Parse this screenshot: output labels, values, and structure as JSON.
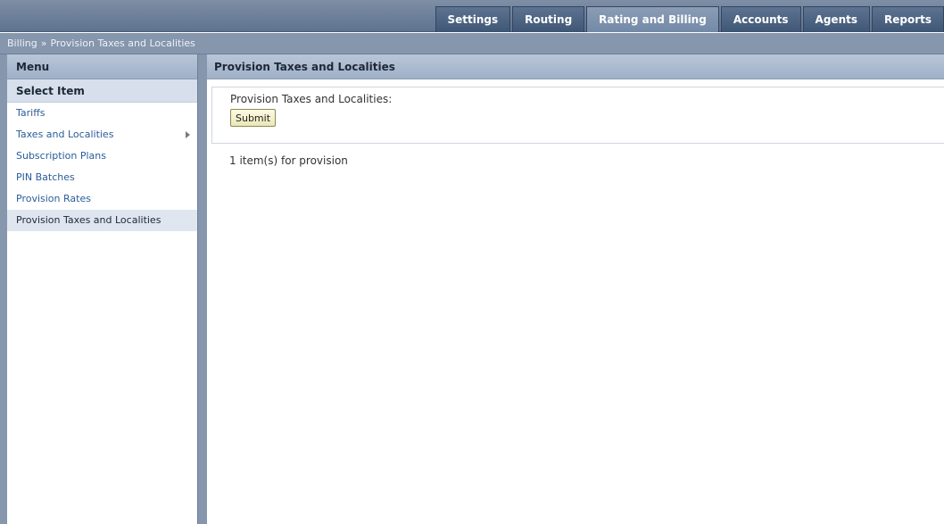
{
  "nav": {
    "tabs": [
      {
        "label": "Settings",
        "active": false
      },
      {
        "label": "Routing",
        "active": false
      },
      {
        "label": "Rating and Billing",
        "active": true
      },
      {
        "label": "Accounts",
        "active": false
      },
      {
        "label": "Agents",
        "active": false
      },
      {
        "label": "Reports",
        "active": false
      }
    ]
  },
  "breadcrumb": {
    "parent": "Billing",
    "separator": "»",
    "current": "Provision Taxes and Localities"
  },
  "sidebar": {
    "title": "Menu",
    "subtitle": "Select Item",
    "items": [
      {
        "label": "Tariffs",
        "has_submenu": false,
        "selected": false
      },
      {
        "label": "Taxes and Localities",
        "has_submenu": true,
        "selected": false
      },
      {
        "label": "Subscription Plans",
        "has_submenu": false,
        "selected": false
      },
      {
        "label": "PIN Batches",
        "has_submenu": false,
        "selected": false
      },
      {
        "label": "Provision Rates",
        "has_submenu": false,
        "selected": false
      },
      {
        "label": "Provision Taxes and Localities",
        "has_submenu": false,
        "selected": true
      }
    ]
  },
  "main": {
    "title": "Provision Taxes and Localities",
    "form_label": "Provision Taxes and Localities:",
    "submit_label": "Submit",
    "status": "1 item(s) for provision"
  },
  "colors": {
    "header_bg": "#5f7390",
    "active_tab": "#7389a6",
    "link": "#2a5c9a",
    "selected_row": "#dfe6f0"
  }
}
